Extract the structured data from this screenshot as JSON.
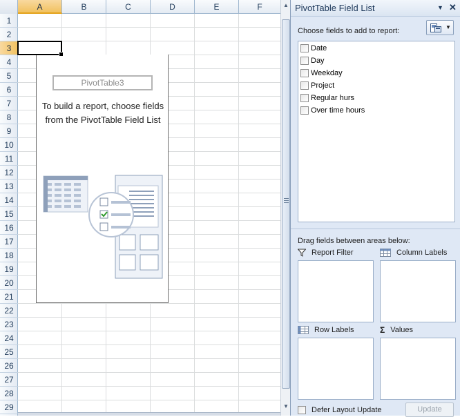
{
  "sheet": {
    "columns": [
      "A",
      "B",
      "C",
      "D",
      "E",
      "F"
    ],
    "rows": [
      "1",
      "2",
      "3",
      "4",
      "5",
      "6",
      "7",
      "8",
      "9",
      "10",
      "11",
      "12",
      "13",
      "14",
      "15",
      "16",
      "17",
      "18",
      "19",
      "20",
      "21",
      "22",
      "23",
      "24",
      "25",
      "26",
      "27",
      "28",
      "29"
    ],
    "active_column": "A",
    "active_row": "3"
  },
  "pivot_placeholder": {
    "name": "PivotTable3",
    "hint": "To build a report, choose fields from the PivotTable Field List"
  },
  "field_list": {
    "title": "PivotTable Field List",
    "menu_icon": "dropdown-arrow",
    "close_icon": "close-x",
    "choose_label": "Choose fields to add to report:",
    "fields": [
      {
        "label": "Date",
        "checked": false
      },
      {
        "label": "Day",
        "checked": false
      },
      {
        "label": "Weekday",
        "checked": false
      },
      {
        "label": "Project",
        "checked": false
      },
      {
        "label": "Regular hurs",
        "checked": false
      },
      {
        "label": "Over time hours",
        "checked": false
      }
    ],
    "drag_label": "Drag fields between areas below:",
    "areas": {
      "report_filter": "Report Filter",
      "column_labels": "Column Labels",
      "row_labels": "Row Labels",
      "values": "Values"
    },
    "defer_label": "Defer Layout Update",
    "defer_checked": false,
    "update_label": "Update"
  },
  "colors": {
    "header_bg": "#e4ebf3",
    "selected_header": "#f1c15f",
    "pane_bg": "#dfe8f5",
    "grid_line": "#dadcdd"
  }
}
